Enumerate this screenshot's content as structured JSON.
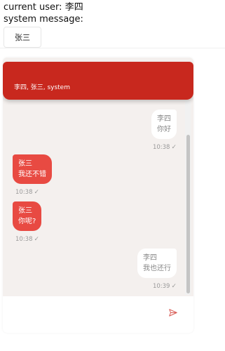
{
  "top": {
    "current_user_label": "current user:",
    "current_user": "李四",
    "system_message_label": "system message:"
  },
  "user_switch_button": "张三",
  "chat": {
    "title": "李四, 张三, system",
    "partial_time": "10:38",
    "messages": [
      {
        "sender": "李四",
        "text": "你好",
        "time": "10:38",
        "side": "right"
      },
      {
        "sender": "张三",
        "text": "我还不错",
        "time": "10:38",
        "side": "left"
      },
      {
        "sender": "张三",
        "text": "你呢?",
        "time": "10:38",
        "side": "left"
      },
      {
        "sender": "李四",
        "text": "我也还行",
        "time": "10:39",
        "side": "right"
      }
    ]
  },
  "icons": {
    "check": "check-icon",
    "send": "send-icon"
  },
  "colors": {
    "header": "#c8281e",
    "incoming_bubble": "#e84a42",
    "chat_background": "#f4f0ee"
  }
}
